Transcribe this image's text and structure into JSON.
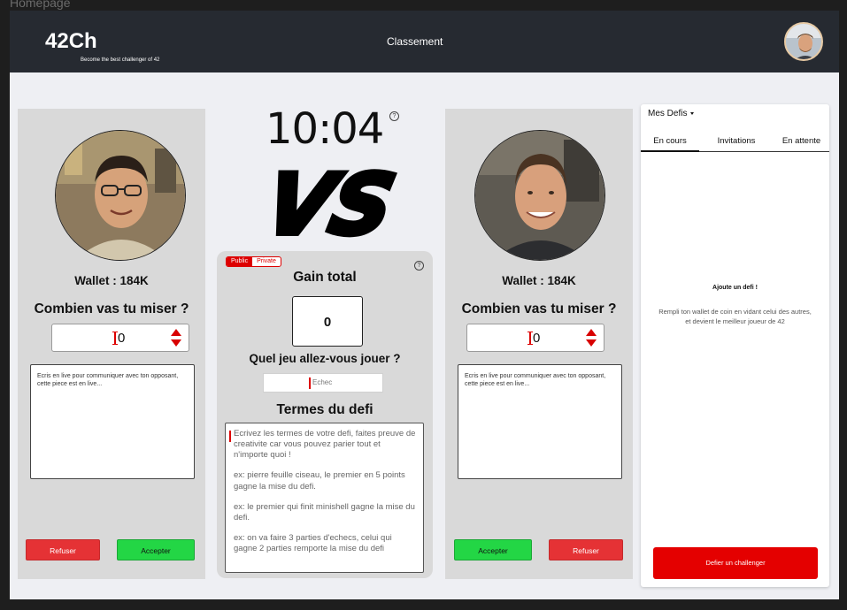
{
  "frame_label": "Homepage",
  "header": {
    "logo": "42Ch",
    "tagline": "Become the best challenger of 42",
    "nav_link": "Classement"
  },
  "left_player": {
    "wallet": "Wallet : 184K",
    "bet_question": "Combien vas tu miser ?",
    "bet_value": "0",
    "chat_placeholder": "Ecris en live pour communiquer avec ton opposant, cette piece est en live...",
    "refuse_label": "Refuser",
    "accept_label": "Accepter"
  },
  "right_player": {
    "wallet": "Wallet : 184K",
    "bet_question": "Combien vas tu miser ?",
    "bet_value": "0",
    "chat_placeholder": "Ecris en live pour communiquer avec ton opposant, cette piece est en live...",
    "accept_label": "Accepter",
    "refuse_label": "Refuser"
  },
  "center": {
    "timer": "10:04",
    "vs_text": "VS",
    "help_glyph": "?",
    "visibility": {
      "public": "Public",
      "private": "Private",
      "selected": "Public"
    },
    "gain_title": "Gain total",
    "gain_value": "0",
    "game_question": "Quel jeu allez-vous jouer ?",
    "game_placeholder": "Echec",
    "terms_title": "Termes du defi",
    "terms_paragraphs": [
      "Ecrivez les termes de votre defi, faites preuve de creativite car vous pouvez parier tout et n'importe quoi !",
      "ex: pierre feuille ciseau, le premier en 5 points gagne la mise du defi.",
      "ex: le premier qui finit minishell gagne la mise du defi.",
      "ex: on va faire 3 parties d'echecs, celui qui gagne 2 parties remporte la mise du defi"
    ]
  },
  "side": {
    "dropdown_label": "Mes Defis",
    "tabs": [
      "En cours",
      "Invitations",
      "En attente"
    ],
    "active_tab": "En cours",
    "empty_title": "Ajoute un defi !",
    "empty_text": "Rempli ton wallet de coin en vidant celui des autres, et devient le meilleur joueur de 42",
    "cta_label": "Defier un challenger"
  },
  "colors": {
    "header_bg": "#262a31",
    "accent_red": "#e40000",
    "accept_green": "#23d645",
    "panel_gray": "#d9d9d9"
  }
}
